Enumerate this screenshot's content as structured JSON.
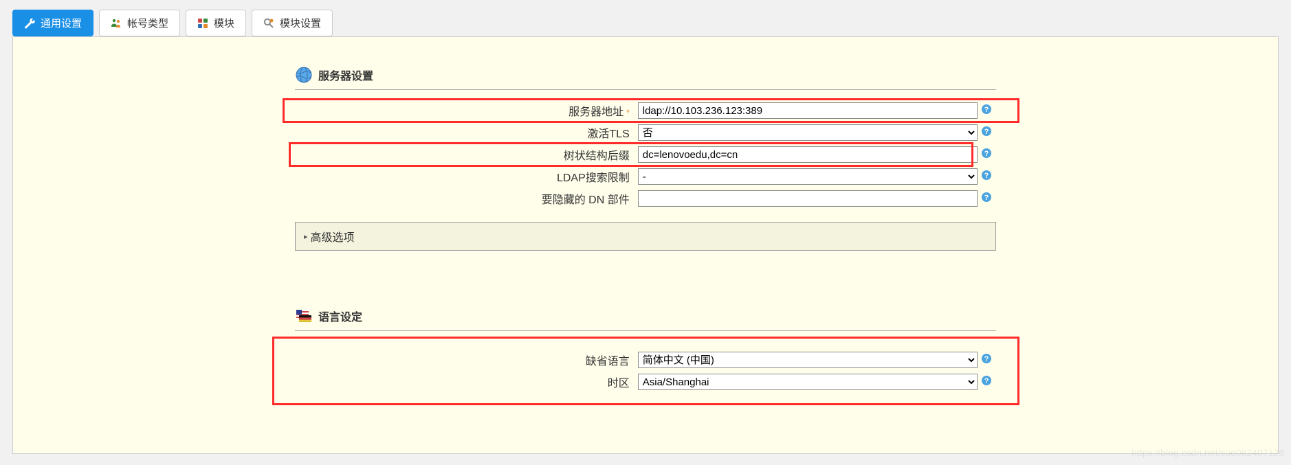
{
  "tabs": [
    {
      "label": "通用设置",
      "icon": "wrench-icon",
      "active": true
    },
    {
      "label": "帐号类型",
      "icon": "accounts-icon",
      "active": false
    },
    {
      "label": "模块",
      "icon": "modules-icon",
      "active": false
    },
    {
      "label": "模块设置",
      "icon": "module-settings-icon",
      "active": false
    }
  ],
  "server_section": {
    "title": "服务器设置",
    "fields": {
      "address_label": "服务器地址",
      "address_value": "ldap://10.103.236.123:389",
      "tls_label": "激活TLS",
      "tls_value": "否",
      "suffix_label": "树状结构后缀",
      "suffix_value": "dc=lenovoedu,dc=cn",
      "search_limit_label": "LDAP搜索限制",
      "search_limit_value": "-",
      "hide_dn_label": "要隐藏的 DN 部件",
      "hide_dn_value": ""
    },
    "advanced_label": "高级选项"
  },
  "language_section": {
    "title": "语言设定",
    "fields": {
      "default_lang_label": "缺省语言",
      "default_lang_value": "简体中文 (中国)",
      "timezone_label": "时区",
      "timezone_value": "Asia/Shanghai"
    }
  },
  "watermark": "https://blog.csdn.net/suo082407128"
}
